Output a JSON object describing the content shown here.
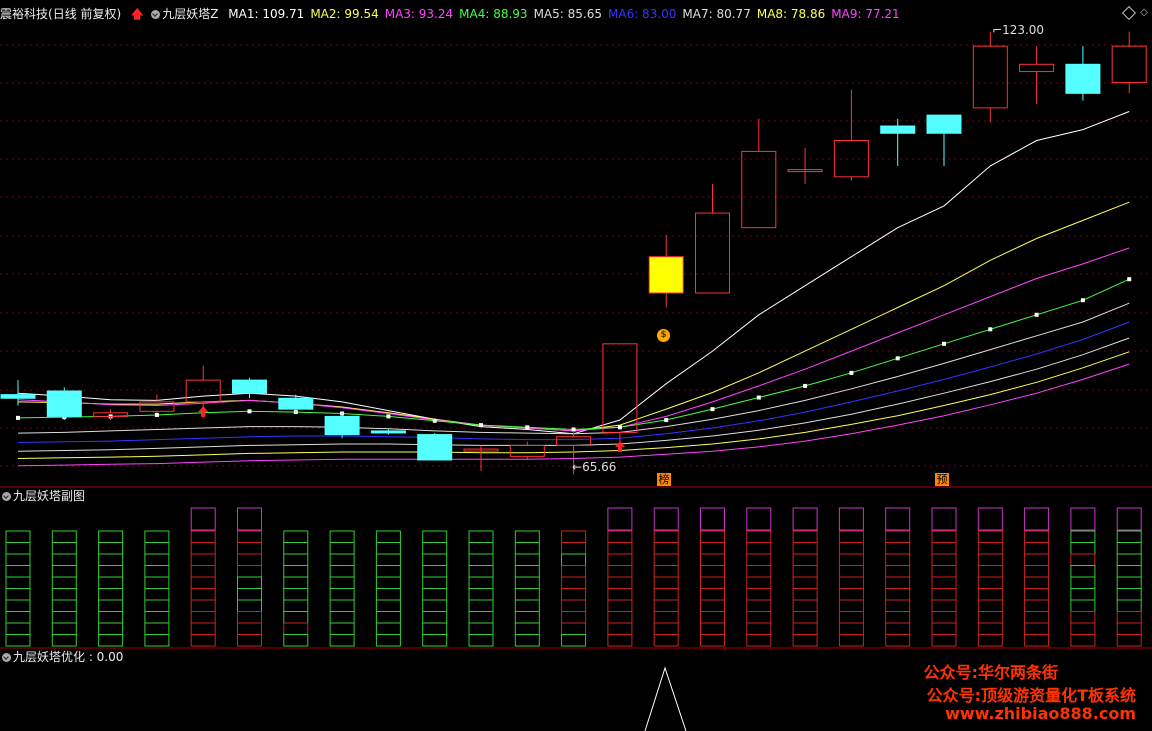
{
  "main_panel": {
    "stock_name": "震裕科技",
    "period": "(日线 前复权)",
    "indicator_name": "九层妖塔Z",
    "ma_labels": [
      {
        "label": "MA1: 109.71",
        "color": "#ffffff"
      },
      {
        "label": "MA2: 99.54",
        "color": "#ffff55"
      },
      {
        "label": "MA3: 93.24",
        "color": "#ff44ff"
      },
      {
        "label": "MA4: 88.93",
        "color": "#44ff44"
      },
      {
        "label": "MA5: 85.65",
        "color": "#dddddd"
      },
      {
        "label": "MA6: 83.00",
        "color": "#3333ff"
      },
      {
        "label": "MA7: 80.77",
        "color": "#dddddd"
      },
      {
        "label": "MA8: 78.86",
        "color": "#ffff55"
      },
      {
        "label": "MA9: 77.21",
        "color": "#ff44ff"
      }
    ],
    "high_label": "123.00",
    "low_label": "65.66",
    "marker_bang": "榜",
    "marker_yu": "预"
  },
  "sub_panel": {
    "title": "九层妖塔副图"
  },
  "bottom_panel": {
    "title": "九层妖塔优化 : 0.00"
  },
  "watermark": {
    "line1": "公众号:华尔两条街",
    "line2": "公众号:顶级游资量化T板系统",
    "line3": "www.zhibiao888.com"
  },
  "colors": {
    "up": "#ff3333",
    "down": "#55ffff",
    "grid": "#7a0000",
    "watermark": "#ff3300",
    "marker_bg": "#ff8800"
  },
  "candles": [
    {
      "o": 73.0,
      "c": 72.5,
      "h": 75.0,
      "l": 71.5
    },
    {
      "o": 73.5,
      "c": 70.0,
      "h": 74.0,
      "l": 69.5
    },
    {
      "o": 70.0,
      "c": 70.5,
      "h": 71.0,
      "l": 69.5
    },
    {
      "o": 70.7,
      "c": 72.0,
      "h": 73.0,
      "l": 70.5
    },
    {
      "o": 72.0,
      "c": 75.0,
      "h": 77.0,
      "l": 71.0
    },
    {
      "o": 75.0,
      "c": 73.2,
      "h": 75.3,
      "l": 72.5
    },
    {
      "o": 72.5,
      "c": 71.0,
      "h": 73.0,
      "l": 70.5
    },
    {
      "o": 70.0,
      "c": 67.5,
      "h": 70.5,
      "l": 67.0
    },
    {
      "o": 68.0,
      "c": 67.8,
      "h": 68.2,
      "l": 67.5
    },
    {
      "o": 67.5,
      "c": 64.0,
      "h": 67.7,
      "l": 64.0
    },
    {
      "o": 65.5,
      "c": 65.5,
      "h": 66.0,
      "l": 62.5
    },
    {
      "o": 64.5,
      "c": 66.0,
      "h": 66.5,
      "l": 64.0
    },
    {
      "o": 66.0,
      "c": 67.2,
      "h": 67.8,
      "l": 62.0
    },
    {
      "o": 67.8,
      "c": 80.0,
      "h": 80.0,
      "l": 66.5
    },
    {
      "o": 87.0,
      "c": 92.0,
      "h": 95.0,
      "l": 85.0,
      "special": "yellow"
    },
    {
      "o": 87.0,
      "c": 98.0,
      "h": 102.0,
      "l": 87.0
    },
    {
      "o": 96.0,
      "c": 106.5,
      "h": 111.0,
      "l": 96.0
    },
    {
      "o": 104.0,
      "c": 104.0,
      "h": 107.0,
      "l": 102.0
    },
    {
      "o": 103.0,
      "c": 108.0,
      "h": 115.0,
      "l": 102.5
    },
    {
      "o": 110.0,
      "c": 109.0,
      "h": 111.0,
      "l": 104.5
    },
    {
      "o": 111.5,
      "c": 109.0,
      "h": 111.5,
      "l": 104.5
    },
    {
      "o": 112.5,
      "c": 121.0,
      "h": 123.0,
      "l": 110.5
    },
    {
      "o": 117.5,
      "c": 118.5,
      "h": 121.0,
      "l": 113.0
    },
    {
      "o": 118.5,
      "c": 114.5,
      "h": 121.0,
      "l": 113.5
    },
    {
      "o": 116.0,
      "c": 121.0,
      "h": 123.0,
      "l": 114.5
    }
  ],
  "ma_lines": [
    {
      "color": "#ffffff",
      "values": [
        73.2,
        72.8,
        72.3,
        72.2,
        72.8,
        73.2,
        72.8,
        72.0,
        70.8,
        69.6,
        68.6,
        68.2,
        67.6,
        69.5,
        74.5,
        79.0,
        84.0,
        88.0,
        92.0,
        96.0,
        99.0,
        104.5,
        108.0,
        109.5,
        112.0
      ]
    },
    {
      "color": "#ffff55",
      "values": [
        72.0,
        71.9,
        71.7,
        71.7,
        72.0,
        72.2,
        71.8,
        71.3,
        70.5,
        69.6,
        68.8,
        68.4,
        68.0,
        68.8,
        71.0,
        73.3,
        76.0,
        79.0,
        82.0,
        85.0,
        88.0,
        91.5,
        94.5,
        97.0,
        99.5
      ]
    },
    {
      "color": "#ff44ff",
      "values": [
        72.3,
        72.0,
        71.6,
        71.5,
        71.8,
        72.2,
        71.8,
        71.2,
        70.4,
        69.5,
        68.8,
        68.4,
        68.0,
        68.5,
        70.0,
        72.0,
        74.2,
        76.5,
        79.0,
        81.5,
        84.0,
        86.5,
        89.0,
        91.0,
        93.2
      ]
    },
    {
      "color": "#44ff44",
      "values": [
        69.8,
        69.9,
        70.0,
        70.2,
        70.5,
        70.7,
        70.6,
        70.4,
        70.0,
        69.4,
        68.8,
        68.5,
        68.2,
        68.5,
        69.5,
        71.0,
        72.6,
        74.2,
        76.0,
        78.0,
        80.0,
        82.0,
        84.0,
        86.0,
        88.9
      ]
    },
    {
      "color": "#dddddd",
      "values": [
        67.7,
        67.8,
        68.0,
        68.2,
        68.4,
        68.6,
        68.6,
        68.5,
        68.3,
        68.0,
        67.8,
        67.7,
        67.6,
        67.8,
        68.6,
        69.6,
        70.8,
        72.2,
        73.8,
        75.5,
        77.3,
        79.2,
        81.1,
        83.0,
        85.6
      ]
    },
    {
      "color": "#3333ff",
      "values": [
        66.4,
        66.5,
        66.6,
        66.8,
        67.0,
        67.2,
        67.3,
        67.3,
        67.2,
        67.1,
        66.9,
        66.8,
        66.8,
        67.0,
        67.6,
        68.4,
        69.4,
        70.6,
        72.0,
        73.5,
        75.1,
        76.8,
        78.6,
        80.6,
        83.0
      ]
    },
    {
      "color": "#dddddd",
      "values": [
        65.2,
        65.3,
        65.4,
        65.6,
        65.8,
        66.0,
        66.1,
        66.2,
        66.2,
        66.1,
        66.0,
        66.0,
        66.0,
        66.2,
        66.7,
        67.3,
        68.1,
        69.1,
        70.3,
        71.7,
        73.2,
        74.8,
        76.5,
        78.5,
        80.8
      ]
    },
    {
      "color": "#ffff55",
      "values": [
        64.2,
        64.3,
        64.4,
        64.5,
        64.7,
        64.9,
        65.0,
        65.1,
        65.1,
        65.1,
        65.0,
        65.0,
        65.1,
        65.3,
        65.7,
        66.2,
        66.9,
        67.8,
        68.9,
        70.1,
        71.5,
        73.0,
        74.7,
        76.7,
        78.9
      ]
    },
    {
      "color": "#ff44ff",
      "values": [
        63.2,
        63.3,
        63.4,
        63.5,
        63.7,
        63.9,
        64.0,
        64.1,
        64.1,
        64.1,
        64.1,
        64.1,
        64.2,
        64.4,
        64.8,
        65.2,
        65.8,
        66.6,
        67.6,
        68.8,
        70.1,
        71.6,
        73.2,
        75.1,
        77.2
      ]
    }
  ],
  "ma_dot_line_index": 3,
  "tower_colors": [
    {
      "top": "",
      "cells": [
        "g",
        "g",
        "g",
        "g",
        "g",
        "g",
        "g",
        "g",
        "g",
        "g"
      ]
    },
    {
      "top": "",
      "cells": [
        "g",
        "g",
        "g",
        "g",
        "g",
        "g",
        "g",
        "g",
        "g",
        "g"
      ]
    },
    {
      "top": "",
      "cells": [
        "g",
        "g",
        "g",
        "g",
        "g",
        "g",
        "g",
        "g",
        "g",
        "g"
      ]
    },
    {
      "top": "",
      "cells": [
        "g",
        "g",
        "g",
        "g",
        "g",
        "g",
        "g",
        "g",
        "g",
        "g"
      ]
    },
    {
      "top": "m",
      "cells": [
        "r",
        "r",
        "r",
        "r",
        "r",
        "r",
        "r",
        "r",
        "r",
        "r"
      ]
    },
    {
      "top": "m",
      "cells": [
        "r",
        "r",
        "r",
        "r",
        "g",
        "g",
        "g",
        "r",
        "r",
        "r"
      ]
    },
    {
      "top": "",
      "cells": [
        "g",
        "g",
        "g",
        "g",
        "g",
        "g",
        "g",
        "g",
        "r",
        "g"
      ]
    },
    {
      "top": "",
      "cells": [
        "g",
        "g",
        "g",
        "g",
        "g",
        "g",
        "g",
        "g",
        "g",
        "g"
      ]
    },
    {
      "top": "",
      "cells": [
        "g",
        "g",
        "g",
        "g",
        "g",
        "g",
        "g",
        "g",
        "g",
        "g"
      ]
    },
    {
      "top": "",
      "cells": [
        "g",
        "g",
        "g",
        "g",
        "g",
        "g",
        "g",
        "g",
        "g",
        "g"
      ]
    },
    {
      "top": "",
      "cells": [
        "g",
        "g",
        "g",
        "g",
        "g",
        "g",
        "g",
        "g",
        "g",
        "g"
      ]
    },
    {
      "top": "",
      "cells": [
        "g",
        "g",
        "g",
        "g",
        "g",
        "g",
        "g",
        "g",
        "g",
        "g"
      ]
    },
    {
      "top": "",
      "cells": [
        "r",
        "r",
        "g",
        "r",
        "r",
        "r",
        "r",
        "r",
        "r",
        "g"
      ]
    },
    {
      "top": "m",
      "cells": [
        "r",
        "r",
        "r",
        "r",
        "r",
        "r",
        "r",
        "r",
        "r",
        "r"
      ]
    },
    {
      "top": "m",
      "cells": [
        "r",
        "r",
        "r",
        "r",
        "r",
        "r",
        "r",
        "r",
        "r",
        "r"
      ]
    },
    {
      "top": "m",
      "cells": [
        "r",
        "r",
        "r",
        "r",
        "r",
        "r",
        "r",
        "r",
        "r",
        "r"
      ]
    },
    {
      "top": "m",
      "cells": [
        "r",
        "r",
        "r",
        "r",
        "r",
        "r",
        "r",
        "r",
        "r",
        "r"
      ]
    },
    {
      "top": "m",
      "cells": [
        "r",
        "r",
        "r",
        "r",
        "r",
        "r",
        "r",
        "r",
        "r",
        "r"
      ]
    },
    {
      "top": "m",
      "cells": [
        "r",
        "r",
        "r",
        "r",
        "r",
        "r",
        "r",
        "r",
        "r",
        "r"
      ]
    },
    {
      "top": "m",
      "cells": [
        "r",
        "r",
        "r",
        "r",
        "r",
        "r",
        "r",
        "r",
        "r",
        "r"
      ]
    },
    {
      "top": "m",
      "cells": [
        "r",
        "r",
        "r",
        "r",
        "r",
        "r",
        "r",
        "r",
        "r",
        "r"
      ]
    },
    {
      "top": "m",
      "cells": [
        "r",
        "r",
        "r",
        "r",
        "r",
        "r",
        "r",
        "r",
        "r",
        "r"
      ]
    },
    {
      "top": "m",
      "cells": [
        "r",
        "r",
        "r",
        "r",
        "r",
        "r",
        "r",
        "r",
        "r",
        "r"
      ]
    },
    {
      "top": "m",
      "cells": [
        "g",
        "g",
        "r",
        "g",
        "g",
        "g",
        "g",
        "r",
        "r",
        "r"
      ]
    },
    {
      "top": "m",
      "cells": [
        "g",
        "g",
        "g",
        "g",
        "g",
        "g",
        "g",
        "r",
        "r",
        "r"
      ]
    }
  ]
}
